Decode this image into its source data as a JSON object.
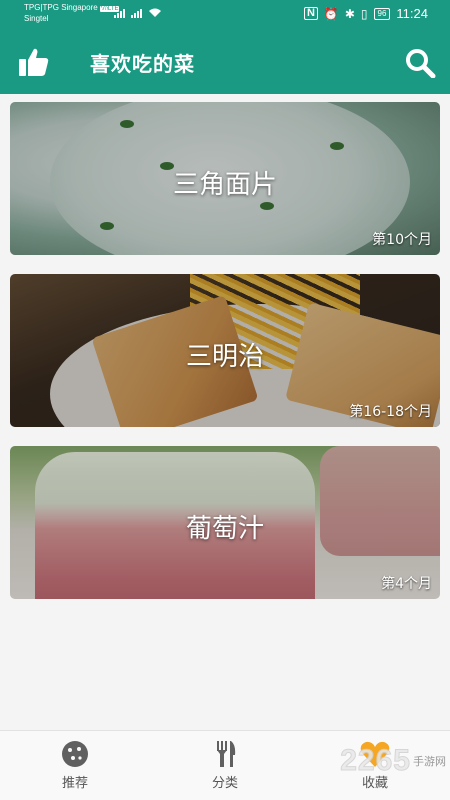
{
  "status_bar": {
    "carrier_line1": "TPG|TPG Singapore",
    "carrier_badge": "VoLTE",
    "carrier_line2": "Singtel",
    "network_label": "4G",
    "battery": "96",
    "time": "11:24"
  },
  "app_bar": {
    "title": "喜欢吃的菜",
    "left_icon": "thumbs-up-icon",
    "right_icon": "search-icon"
  },
  "dishes": [
    {
      "name": "三角面片",
      "age": "第10个月"
    },
    {
      "name": "三明治",
      "age": "第16-18个月"
    },
    {
      "name": "葡萄汁",
      "age": "第4个月"
    }
  ],
  "bottom_nav": {
    "tabs": [
      {
        "label": "推荐",
        "icon": "cookie-icon"
      },
      {
        "label": "分类",
        "icon": "utensils-icon"
      },
      {
        "label": "收藏",
        "icon": "heart-icon"
      }
    ]
  },
  "watermark": {
    "number": "2265",
    "text": "手游网"
  },
  "colors": {
    "primary": "#1a9a83",
    "accent_heart": "#f5a623",
    "tab_icon": "#606060"
  }
}
